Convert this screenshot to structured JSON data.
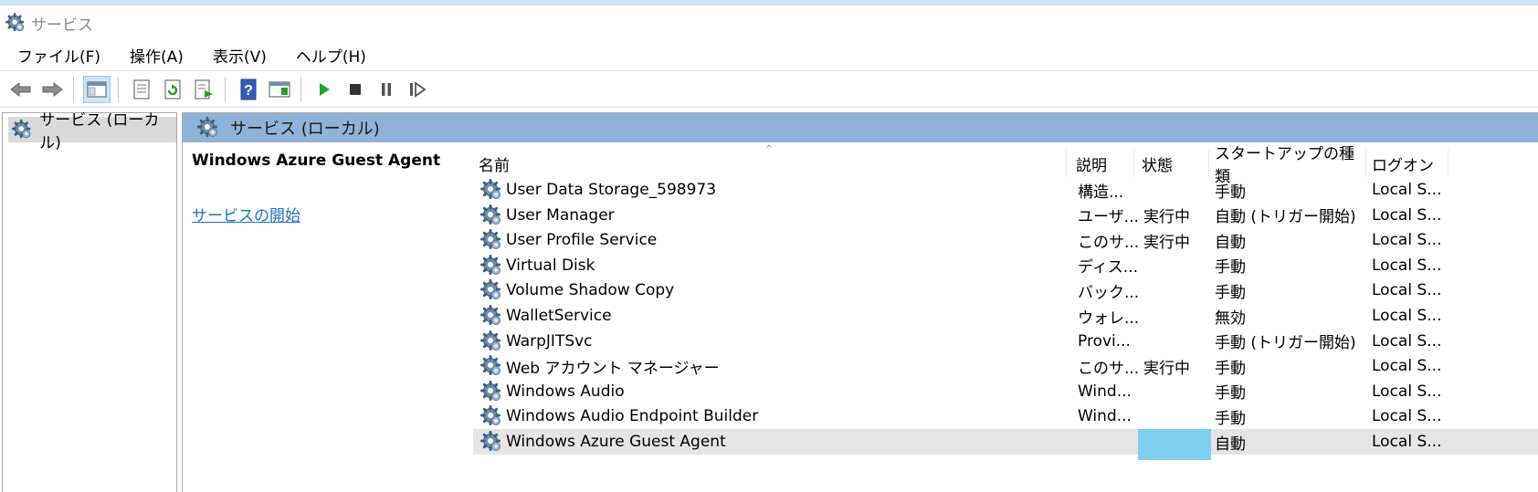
{
  "window": {
    "title": "サービス"
  },
  "menu": [
    {
      "label": "ファイル(F)"
    },
    {
      "label": "操作(A)"
    },
    {
      "label": "表示(V)"
    },
    {
      "label": "ヘルプ(H)"
    }
  ],
  "toolbar": {
    "icons": [
      "back-arrow-icon",
      "forward-arrow-icon",
      "console-tree-icon",
      "properties-icon",
      "refresh-icon",
      "export-list-icon",
      "help-icon",
      "show-action-pane-icon",
      "start-service-icon",
      "stop-service-icon",
      "pause-service-icon",
      "resume-service-icon"
    ]
  },
  "tree": {
    "item_label": "サービス (ローカル)"
  },
  "right_header": {
    "title": "サービス (ローカル)"
  },
  "detail": {
    "service_name": "Windows Azure Guest Agent",
    "start_link": "サービスの開始"
  },
  "columns": {
    "name": "名前",
    "description": "説明",
    "state": "状態",
    "startup_type": "スタートアップの種類",
    "logon": "ログオン"
  },
  "services": [
    {
      "name": "User Data Storage_598973",
      "description": "構造...",
      "state": "",
      "startup_type": "手動",
      "logon": "Local S..."
    },
    {
      "name": "User Manager",
      "description": "ユーザ...",
      "state": "実行中",
      "startup_type": "自動 (トリガー開始)",
      "logon": "Local S..."
    },
    {
      "name": "User Profile Service",
      "description": "このサ...",
      "state": "実行中",
      "startup_type": "自動",
      "logon": "Local S..."
    },
    {
      "name": "Virtual Disk",
      "description": "ディス...",
      "state": "",
      "startup_type": "手動",
      "logon": "Local S..."
    },
    {
      "name": "Volume Shadow Copy",
      "description": "バック...",
      "state": "",
      "startup_type": "手動",
      "logon": "Local S..."
    },
    {
      "name": "WalletService",
      "description": "ウォレ...",
      "state": "",
      "startup_type": "無効",
      "logon": "Local S..."
    },
    {
      "name": "WarpJITSvc",
      "description": "Provi...",
      "state": "",
      "startup_type": "手動 (トリガー開始)",
      "logon": "Local S..."
    },
    {
      "name": "Web アカウント マネージャー",
      "description": "このサ...",
      "state": "実行中",
      "startup_type": "手動",
      "logon": "Local S..."
    },
    {
      "name": "Windows Audio",
      "description": "Wind...",
      "state": "",
      "startup_type": "手動",
      "logon": "Local S..."
    },
    {
      "name": "Windows Audio Endpoint Builder",
      "description": "Wind...",
      "state": "",
      "startup_type": "手動",
      "logon": "Local S..."
    },
    {
      "name": "Windows Azure Guest Agent",
      "description": "",
      "state": "",
      "startup_type": "自動",
      "logon": "Local S...",
      "selected": true
    }
  ],
  "colors": {
    "header_blue": "#8fb3d6",
    "selection_highlight": "#7fd0ef",
    "link_blue": "#1f6fbf",
    "row_selected": "#e5e5e5"
  }
}
